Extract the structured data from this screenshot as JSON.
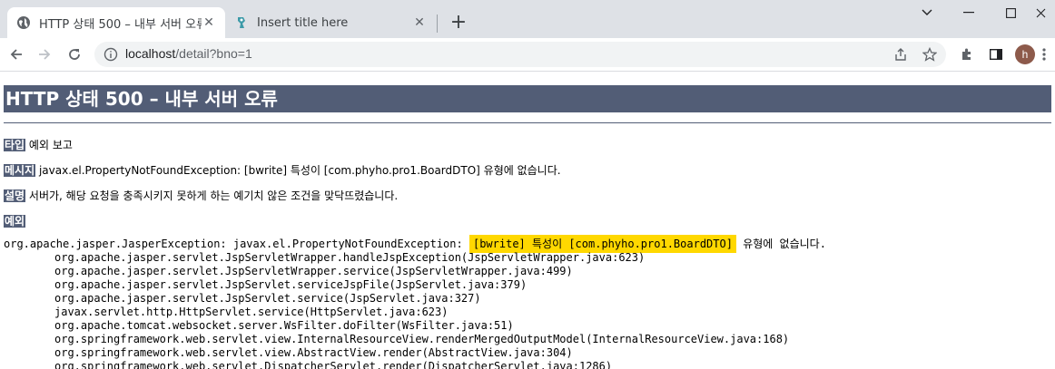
{
  "browser": {
    "tabs": [
      {
        "title": "HTTP 상태 500 – 내부 서버 오류",
        "favicon": "globe-icon",
        "active": true
      },
      {
        "title": "Insert title here",
        "favicon": "eclipse-icon",
        "active": false
      }
    ],
    "url_host": "localhost",
    "url_path": "/detail?bno=1",
    "profile_initial": "h"
  },
  "page": {
    "heading": "HTTP 상태 500 – 내부 서버 오류",
    "type_label": "타입",
    "type_value": "예외 보고",
    "message_label": "메시지",
    "message_value": "javax.el.PropertyNotFoundException: [bwrite] 특성이 [com.phyho.pro1.BoardDTO] 유형에 없습니다.",
    "description_label": "설명",
    "description_value": "서버가, 해당 요청을 충족시키지 못하게 하는 예기치 않은 조건을 맞닥뜨렸습니다.",
    "exception_label": "예외",
    "exception_prefix": "org.apache.jasper.JasperException: javax.el.PropertyNotFoundException:",
    "exception_highlight": "[bwrite] 특성이 [com.phyho.pro1.BoardDTO]",
    "exception_suffix": "유형에 없습니다.",
    "stack": [
      "org.apache.jasper.servlet.JspServletWrapper.handleJspException(JspServletWrapper.java:623)",
      "org.apache.jasper.servlet.JspServletWrapper.service(JspServletWrapper.java:499)",
      "org.apache.jasper.servlet.JspServlet.serviceJspFile(JspServlet.java:379)",
      "org.apache.jasper.servlet.JspServlet.service(JspServlet.java:327)",
      "javax.servlet.http.HttpServlet.service(HttpServlet.java:623)",
      "org.apache.tomcat.websocket.server.WsFilter.doFilter(WsFilter.java:51)",
      "org.springframework.web.servlet.view.InternalResourceView.renderMergedOutputModel(InternalResourceView.java:168)",
      "org.springframework.web.servlet.view.AbstractView.render(AbstractView.java:304)",
      "org.springframework.web.servlet.DispatcherServlet.render(DispatcherServlet.java:1286)"
    ]
  }
}
